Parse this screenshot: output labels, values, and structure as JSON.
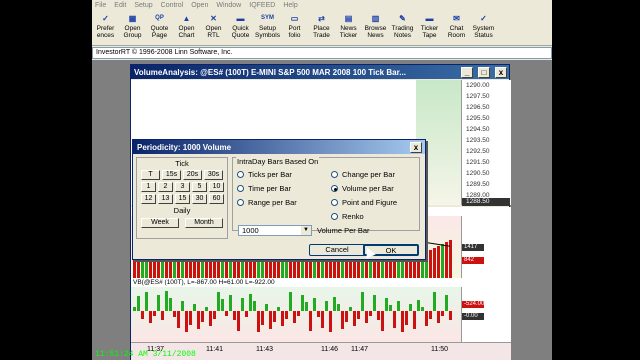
{
  "menu": [
    "File",
    "Edit",
    "Setup",
    "Control",
    "Open",
    "Window",
    "IQFEED",
    "Help"
  ],
  "toolbar": [
    {
      "label": "Prefer\nences",
      "icon": "preferences-icon",
      "glyph": "✓"
    },
    {
      "label": "Open\nGroup",
      "icon": "open-group-icon",
      "glyph": "▦"
    },
    {
      "label": "Quote\nPage",
      "icon": "quote-page-icon",
      "glyph": "QP"
    },
    {
      "label": "Open\nChart",
      "icon": "chart-icon",
      "glyph": "▲"
    },
    {
      "label": "Open\nRTL",
      "icon": "rtl-icon",
      "glyph": "✕"
    },
    {
      "label": "Quick\nQuote",
      "icon": "quick-quote-icon",
      "glyph": "▬"
    },
    {
      "label": "Setup\nSymbols",
      "icon": "symbols-icon",
      "glyph": "SYM"
    },
    {
      "label": "Port\nfolio",
      "icon": "portfolio-icon",
      "glyph": "▭"
    },
    {
      "label": "Place\nTrade",
      "icon": "trade-icon",
      "glyph": "⇄"
    },
    {
      "label": "News\nTicker",
      "icon": "news-ticker-icon",
      "glyph": "▤"
    },
    {
      "label": "Browse\nNews",
      "icon": "browse-news-icon",
      "glyph": "▥"
    },
    {
      "label": "Trading\nNotes",
      "icon": "notes-icon",
      "glyph": "✎"
    },
    {
      "label": "Ticker\nTape",
      "icon": "ticker-tape-icon",
      "glyph": "▬"
    },
    {
      "label": "Chat\nRoom",
      "icon": "chat-icon",
      "glyph": "✉"
    },
    {
      "label": "System\nStatus",
      "icon": "status-icon",
      "glyph": "✓"
    }
  ],
  "infobar": "InvestorRT © 1996-2008 Linn Software, Inc.",
  "chart_window": {
    "title": "VolumeAnalysis: @ES# (100T) E-MINI S&P 500 MAR 2008 100 Tick Bar...",
    "btn_min": "_",
    "btn_max": "□",
    "btn_close": "x",
    "price_labels": [
      "1290.00",
      "1297.50",
      "1296.50",
      "1295.50",
      "1294.50",
      "1293.50",
      "1292.50",
      "1291.50",
      "1290.50",
      "1289.50",
      "1289.00"
    ],
    "price_last": "1288.50",
    "date_label": "3-11",
    "vol_label": "VOL(@ES# (100T), S,20)=1236 VOL(@ES# (100T))=1503",
    "vol_tag_top": "1417",
    "vol_tag_mid": "842",
    "vb_label": "VB(@ES# (100T), L=-867.00 H=61.00 L=-922.00",
    "vb_tag": "-524.00",
    "vb_tag2": "-0.00",
    "times": [
      "11:37",
      "11:41",
      "11:43",
      "11:46",
      "11:47",
      "11:50"
    ]
  },
  "dialog": {
    "title": "Periodicity: 1000 Volume",
    "close": "x",
    "tick": "Tick",
    "row1": [
      "T",
      "15s",
      "20s",
      "30s"
    ],
    "row2": [
      "1",
      "2",
      "3",
      "5",
      "10"
    ],
    "row3": [
      "12",
      "13",
      "15",
      "30",
      "60"
    ],
    "daily": "Daily",
    "week": "Week",
    "month": "Month",
    "group_title": "IntraDay Bars Based On",
    "options": [
      "Ticks per Bar",
      "Time per Bar",
      "Range per Bar",
      "Change per Bar",
      "Volume per Bar",
      "Point and Figure",
      "Renko"
    ],
    "selected_option": "Volume per Bar",
    "value": "1000",
    "value_label": "Volume Per Bar",
    "cancel": "Cancel",
    "ok": "OK"
  },
  "clock": "11:51:24 AM 3/11/2008",
  "colors": {
    "up_bar": "#cc1111",
    "down_bar": "#22aa22",
    "title_blue": "#0a246a"
  }
}
